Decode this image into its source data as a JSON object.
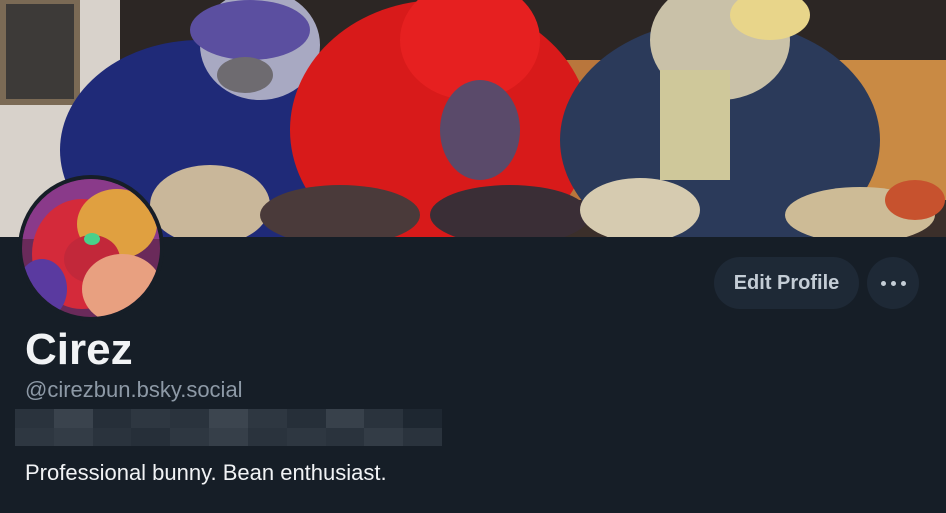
{
  "profile": {
    "display_name": "Cirez",
    "handle": "@cirezbun.bsky.social",
    "bio": "Professional bunny. Bean enthusiast."
  },
  "actions": {
    "edit_label": "Edit Profile",
    "more_icon": "ellipsis-icon"
  },
  "colors": {
    "background": "#161e27",
    "button_bg": "#1e2936",
    "handle_text": "#8d99a6"
  }
}
